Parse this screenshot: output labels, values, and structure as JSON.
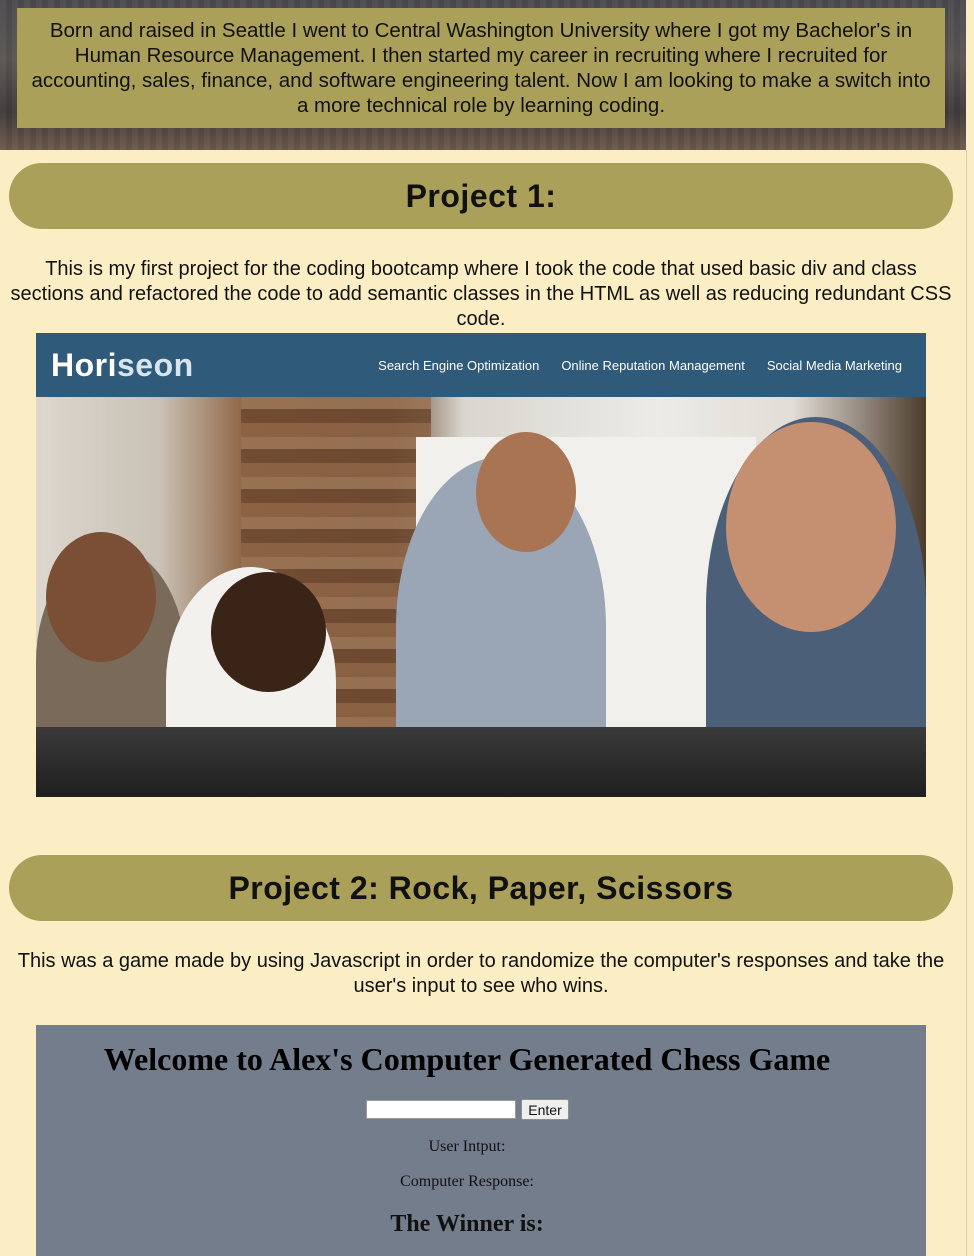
{
  "about": {
    "bio": "Born and raised in Seattle I went to Central Washington University where I got my Bachelor's in Human Resource Management. I then started my career in recruiting where I recruited for accounting, sales, finance, and software engineering talent. Now I am looking to make a switch into a more technical role by learning coding."
  },
  "project1": {
    "title": "Project 1:",
    "description": "This is my first project for the coding bootcamp where I took the code that used basic div and class sections and refactored the code to add semantic classes in the HTML as well as reducing redundant CSS code.",
    "screenshot": {
      "brand_part1": "Hori",
      "brand_part2": "seon",
      "nav": [
        "Search Engine Optimization",
        "Online Reputation Management",
        "Social Media Marketing"
      ]
    }
  },
  "project2": {
    "title": "Project 2: Rock, Paper, Scissors",
    "description": "This was a game made by using Javascript in order to randomize the computer's responses and take the user's input to see who wins.",
    "game": {
      "heading": "Welcome to Alex's Computer Generated Chess Game",
      "input_value": "",
      "enter_label": "Enter",
      "user_input_label": "User Intput:",
      "computer_response_label": "Computer Response:",
      "winner_label": "The Winner is:"
    }
  },
  "colors": {
    "page_bg": "#fbeec5",
    "accent": "#aba05a",
    "nav_blue": "#2f5a79",
    "game_bg": "#737d8c"
  }
}
